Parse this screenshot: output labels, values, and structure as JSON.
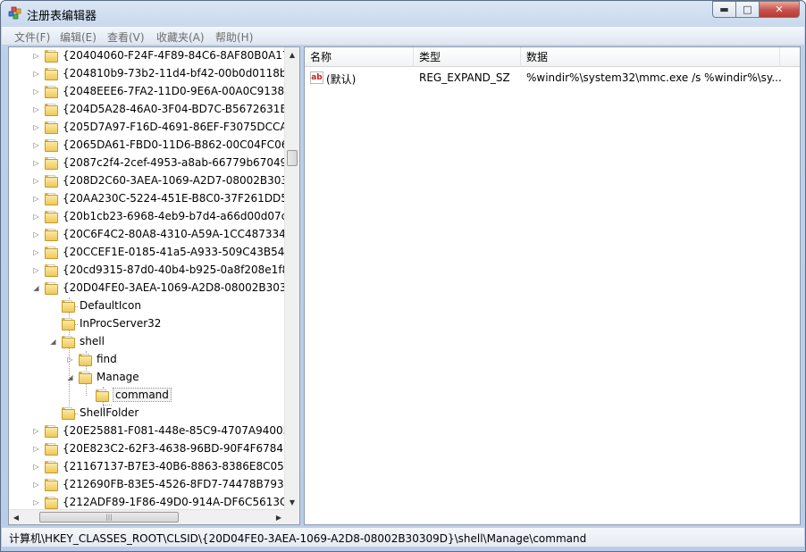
{
  "window": {
    "title": "注册表编辑器"
  },
  "menu": [
    "文件(F)",
    "编辑(E)",
    "查看(V)",
    "收藏夹(A)",
    "帮助(H)"
  ],
  "tree": {
    "items": [
      {
        "label": "{20404060-F24F-4F89-84C6-8AF80B0A17",
        "expander": "collapsed"
      },
      {
        "label": "{204810b9-73b2-11d4-bf42-00b0d0118b",
        "expander": "collapsed"
      },
      {
        "label": "{2048EEE6-7FA2-11D0-9E6A-00A0C91380",
        "expander": "collapsed"
      },
      {
        "label": "{204D5A28-46A0-3F04-BD7C-B5672631E",
        "expander": "collapsed"
      },
      {
        "label": "{205D7A97-F16D-4691-86EF-F3075DCCA",
        "expander": "collapsed"
      },
      {
        "label": "{2065DA61-FBD0-11D6-B862-00C04FC06",
        "expander": "collapsed"
      },
      {
        "label": "{2087c2f4-2cef-4953-a8ab-66779b67049",
        "expander": "collapsed"
      },
      {
        "label": "{208D2C60-3AEA-1069-A2D7-08002B303",
        "expander": "collapsed"
      },
      {
        "label": "{20AA230C-5224-451E-B8C0-37F261DD5",
        "expander": "collapsed"
      },
      {
        "label": "{20b1cb23-6968-4eb9-b7d4-a66d00d07c",
        "expander": "collapsed"
      },
      {
        "label": "{20C6F4C2-80A8-4310-A59A-1CC487334",
        "expander": "collapsed"
      },
      {
        "label": "{20CCEF1E-0185-41a5-A933-509C43B54F",
        "expander": "collapsed"
      },
      {
        "label": "{20cd9315-87d0-40b4-b925-0a8f208e1f8",
        "expander": "collapsed"
      },
      {
        "label": "{20D04FE0-3AEA-1069-A2D8-08002B3030",
        "expander": "expanded"
      },
      {
        "label": "DefaultIcon",
        "expander": "none"
      },
      {
        "label": "InProcServer32",
        "expander": "none"
      },
      {
        "label": "shell",
        "expander": "expanded"
      },
      {
        "label": "find",
        "expander": "collapsed"
      },
      {
        "label": "Manage",
        "expander": "expanded"
      },
      {
        "label": "command",
        "expander": "none",
        "selected": true
      },
      {
        "label": "ShellFolder",
        "expander": "none"
      },
      {
        "label": "{20E25881-F081-448e-85C9-4707A94005",
        "expander": "collapsed"
      },
      {
        "label": "{20E823C2-62F3-4638-96BD-90F4F6784E",
        "expander": "collapsed"
      },
      {
        "label": "{21167137-B7E3-40B6-8863-8386E8C057",
        "expander": "collapsed"
      },
      {
        "label": "{212690FB-83E5-4526-8FD7-74478B7939",
        "expander": "collapsed"
      },
      {
        "label": "{212ADF89-1F86-49D0-914A-DF6C5613C",
        "expander": "collapsed"
      }
    ]
  },
  "list": {
    "headers": {
      "name": "名称",
      "type": "类型",
      "data": "数据"
    },
    "rows": [
      {
        "name": "(默认)",
        "type": "REG_EXPAND_SZ",
        "data": "%windir%\\system32\\mmc.exe /s %windir%\\sy..."
      }
    ]
  },
  "statusbar": {
    "path": "计算机\\HKEY_CLASSES_ROOT\\CLSID\\{20D04FE0-3AEA-1069-A2D8-08002B30309D}\\shell\\Manage\\command"
  },
  "colors": {
    "accent": "#c32020",
    "folder": "#efc85a",
    "frame": "#bcd0ea"
  },
  "icons": {
    "app": "registry-cube-icon",
    "value": "string-value-ab-icon"
  }
}
